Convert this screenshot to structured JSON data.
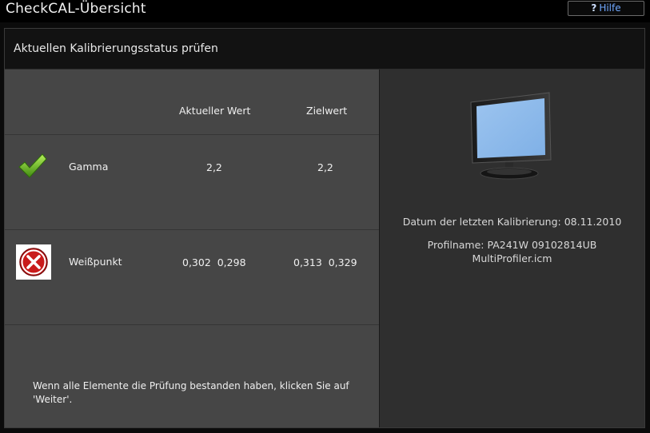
{
  "window": {
    "title": "CheckCAL-Übersicht",
    "help_label": "Hilfe"
  },
  "section": {
    "title": "Aktuellen Kalibrierungsstatus prüfen"
  },
  "table": {
    "headers": {
      "current": "Aktueller Wert",
      "target": "Zielwert"
    },
    "rows": [
      {
        "status": "pass",
        "status_icon": "checkmark-icon",
        "label": "Gamma",
        "current": "2,2",
        "target": "2,2"
      },
      {
        "status": "fail",
        "status_icon": "error-x-icon",
        "label": "Weißpunkt",
        "current": "0,302  0,298",
        "target": "0,313  0,329"
      }
    ]
  },
  "footer": {
    "instruction": "Wenn alle Elemente die Prüfung bestanden haben, klicken Sie auf 'Weiter'."
  },
  "info": {
    "monitor_icon": "monitor-icon",
    "last_calibration": "Datum der letzten Kalibrierung: 08.11.2010",
    "profile_line1": "Profilname: PA241W 09102814UB",
    "profile_line2": "MultiProfiler.icm"
  },
  "colors": {
    "pass": "#6fb825",
    "fail": "#d61f1f",
    "help_text": "#6fa8ff"
  }
}
